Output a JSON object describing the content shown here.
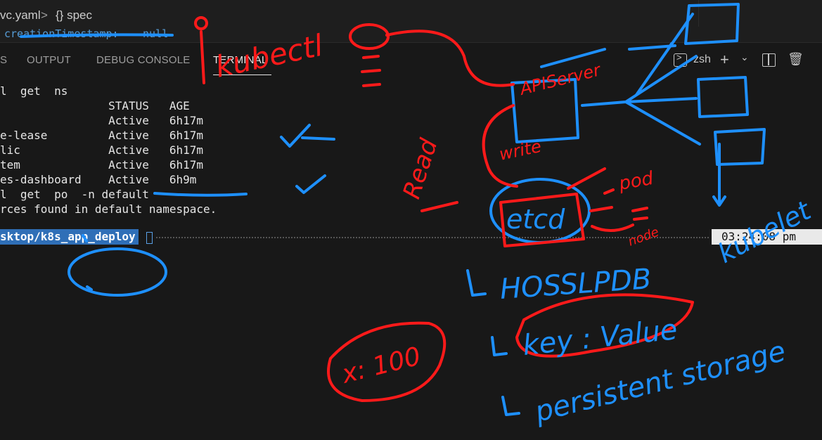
{
  "editor": {
    "breadcrumb_file": "vc.yaml",
    "breadcrumb_separator": ">",
    "breadcrumb_symbol": "{} spec",
    "code_key": "creationTimestamp:",
    "code_value": "null"
  },
  "panel": {
    "tabs": [
      {
        "label": "S"
      },
      {
        "label": "OUTPUT"
      },
      {
        "label": "DEBUG CONSOLE"
      },
      {
        "label": "TERMINAL"
      }
    ],
    "shell_name": "zsh",
    "icons": [
      "terminal-icon",
      "plus-icon",
      "chevron-down-icon",
      "split-icon",
      "trash-icon"
    ]
  },
  "terminal": {
    "lines": [
      "l  get  ns",
      "                STATUS   AGE",
      "                Active   6h17m",
      "e-lease         Active   6h17m",
      "lic             Active   6h17m",
      "tem             Active   6h17m",
      "es-dashboard    Active   6h9m",
      "l  get  po  -n default",
      "rces found in default namespace."
    ],
    "prompt_path": "sktop/k8s_app_deploy",
    "clock": "03:24:08 pm"
  },
  "annotations": {
    "red": [
      "kubectl",
      "APIServer",
      "write",
      "Read",
      "etcd",
      "pod",
      "node",
      "x: 100"
    ],
    "blue": [
      "HOSSLPDB",
      "key : Value",
      "persistent storage",
      "kubelet"
    ]
  },
  "colors": {
    "red_ink": "#ff1a1a",
    "blue_ink": "#1e90ff",
    "prompt_bg": "#2f6fb7"
  }
}
